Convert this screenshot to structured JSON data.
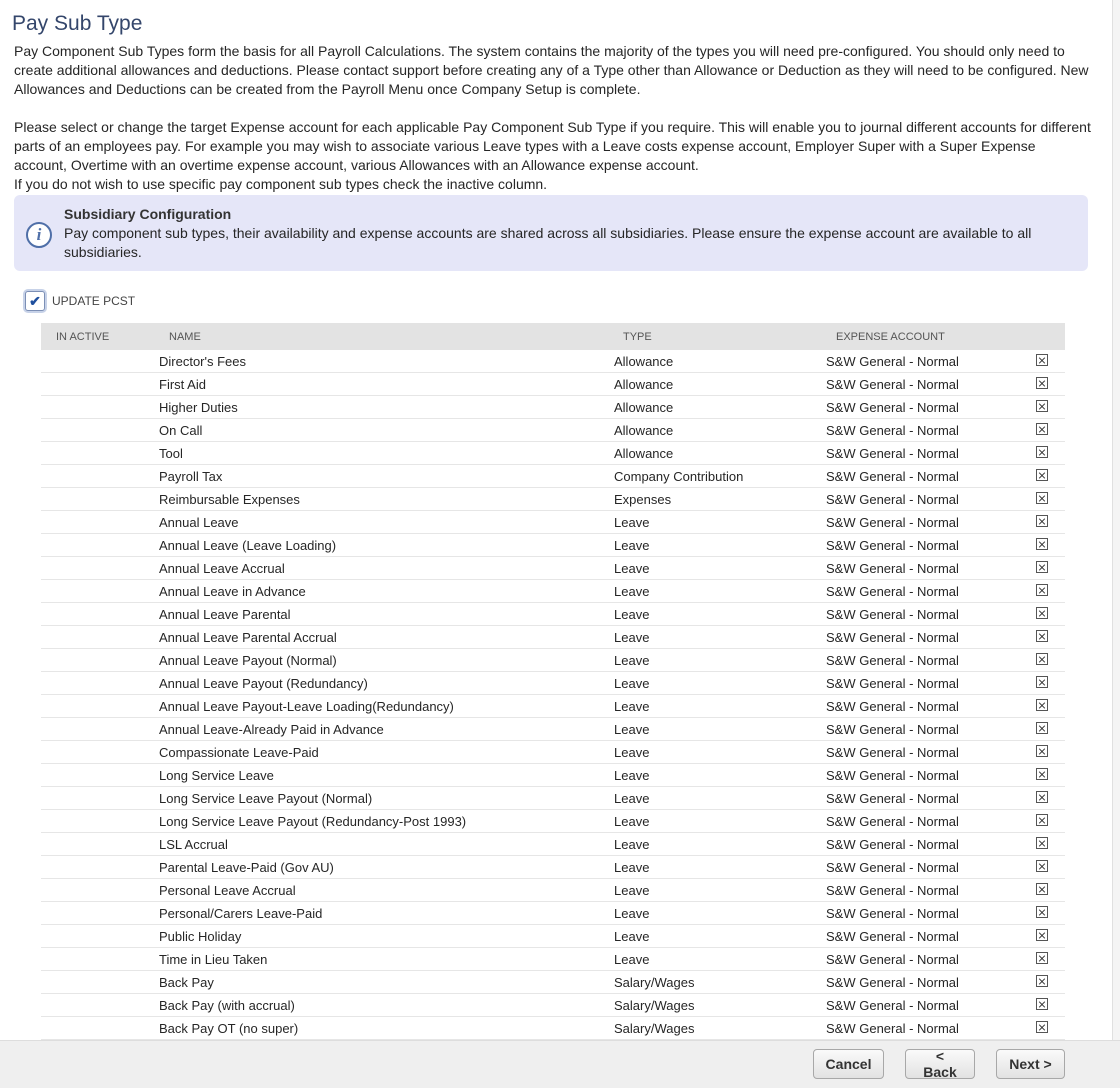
{
  "page": {
    "title": "Pay Sub Type",
    "intro_para1": "Pay Component Sub Types form the basis for all Payroll Calculations. The system contains the majority of the types you will need pre-configured. You should only need to create additional allowances and deductions. Please contact support before creating any of a Type other than Allowance or Deduction as they will need to be configured. New Allowances and Deductions can be created from the Payroll Menu once Company Setup is complete.",
    "intro_para2": "Please select or change the target Expense account for each applicable Pay Component Sub Type if you require. This will enable you to journal different accounts for different parts of an employees pay. For example you may wish to associate various Leave types with a Leave costs expense account, Employer Super with a Super Expense account, Overtime with an overtime expense account, various Allowances with an Allowance expense account.",
    "intro_para3": "If you do not wish to use specific pay component sub types check the inactive column."
  },
  "info": {
    "icon": "info-icon",
    "title": "Subsidiary Configuration",
    "body": "Pay component sub types, their availability and expense accounts are shared across all subsidiaries. Please ensure the expense account are available to all subsidiaries."
  },
  "update_pcst": {
    "label": "UPDATE PCST",
    "checked": true
  },
  "table": {
    "headers": {
      "inactive": "IN ACTIVE",
      "name": "NAME",
      "type": "TYPE",
      "expense": "EXPENSE ACCOUNT"
    },
    "rows": [
      {
        "name": "Director's Fees",
        "type": "Allowance",
        "expense": "S&W General - Normal"
      },
      {
        "name": "First Aid",
        "type": "Allowance",
        "expense": "S&W General - Normal"
      },
      {
        "name": "Higher Duties",
        "type": "Allowance",
        "expense": "S&W General - Normal"
      },
      {
        "name": "On Call",
        "type": "Allowance",
        "expense": "S&W General - Normal"
      },
      {
        "name": "Tool",
        "type": "Allowance",
        "expense": "S&W General - Normal"
      },
      {
        "name": "Payroll Tax",
        "type": "Company Contribution",
        "expense": "S&W General - Normal"
      },
      {
        "name": "Reimbursable Expenses",
        "type": "Expenses",
        "expense": "S&W General - Normal"
      },
      {
        "name": "Annual Leave",
        "type": "Leave",
        "expense": "S&W General - Normal"
      },
      {
        "name": "Annual Leave (Leave Loading)",
        "type": "Leave",
        "expense": "S&W General - Normal"
      },
      {
        "name": "Annual Leave Accrual",
        "type": "Leave",
        "expense": "S&W General - Normal"
      },
      {
        "name": "Annual Leave in Advance",
        "type": "Leave",
        "expense": "S&W General - Normal"
      },
      {
        "name": "Annual Leave Parental",
        "type": "Leave",
        "expense": "S&W General - Normal"
      },
      {
        "name": "Annual Leave Parental Accrual",
        "type": "Leave",
        "expense": "S&W General - Normal"
      },
      {
        "name": "Annual Leave Payout (Normal)",
        "type": "Leave",
        "expense": "S&W General - Normal"
      },
      {
        "name": "Annual Leave Payout (Redundancy)",
        "type": "Leave",
        "expense": "S&W General - Normal"
      },
      {
        "name": "Annual Leave Payout-Leave Loading(Redundancy)",
        "type": "Leave",
        "expense": "S&W General - Normal"
      },
      {
        "name": "Annual Leave-Already Paid in Advance",
        "type": "Leave",
        "expense": "S&W General - Normal"
      },
      {
        "name": "Compassionate Leave-Paid",
        "type": "Leave",
        "expense": "S&W General - Normal"
      },
      {
        "name": "Long Service Leave",
        "type": "Leave",
        "expense": "S&W General - Normal"
      },
      {
        "name": "Long Service Leave Payout (Normal)",
        "type": "Leave",
        "expense": "S&W General - Normal"
      },
      {
        "name": "Long Service Leave Payout (Redundancy-Post 1993)",
        "type": "Leave",
        "expense": "S&W General - Normal"
      },
      {
        "name": "LSL Accrual",
        "type": "Leave",
        "expense": "S&W General - Normal"
      },
      {
        "name": "Parental Leave-Paid (Gov AU)",
        "type": "Leave",
        "expense": "S&W General - Normal"
      },
      {
        "name": "Personal Leave Accrual",
        "type": "Leave",
        "expense": "S&W General - Normal"
      },
      {
        "name": "Personal/Carers Leave-Paid",
        "type": "Leave",
        "expense": "S&W General - Normal"
      },
      {
        "name": "Public Holiday",
        "type": "Leave",
        "expense": "S&W General - Normal"
      },
      {
        "name": "Time in Lieu Taken",
        "type": "Leave",
        "expense": "S&W General - Normal"
      },
      {
        "name": "Back Pay",
        "type": "Salary/Wages",
        "expense": "S&W General - Normal"
      },
      {
        "name": "Back Pay (with accrual)",
        "type": "Salary/Wages",
        "expense": "S&W General - Normal"
      },
      {
        "name": "Back Pay OT (no super)",
        "type": "Salary/Wages",
        "expense": "S&W General - Normal"
      }
    ]
  },
  "footer": {
    "cancel": "Cancel",
    "back": "< Back",
    "next": "Next >"
  }
}
